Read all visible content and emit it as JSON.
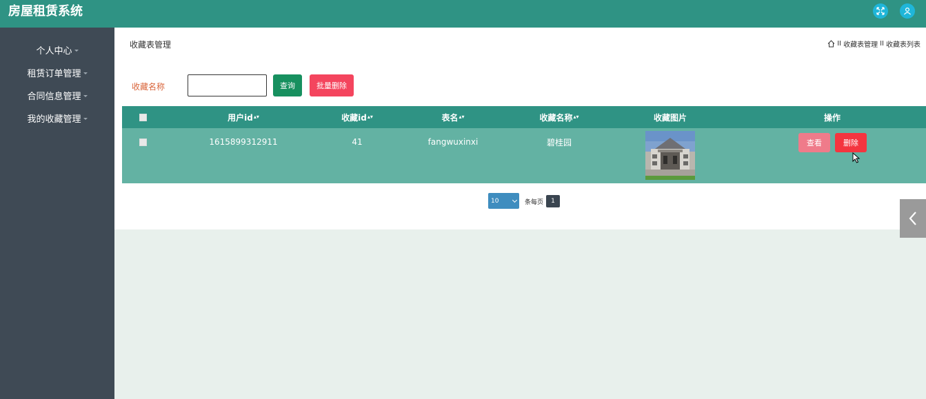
{
  "app": {
    "title": "房屋租赁系统"
  },
  "header": {
    "fullscreen_icon": "fullscreen-icon",
    "user_icon": "user-icon",
    "accent_color": "#1fb6d9",
    "bar_color": "#2f9384"
  },
  "sidebar": {
    "items": [
      {
        "label": "个人中心"
      },
      {
        "label": "租赁订单管理"
      },
      {
        "label": "合同信息管理"
      },
      {
        "label": "我的收藏管理"
      }
    ]
  },
  "page": {
    "title": "收藏表管理",
    "breadcrumb": [
      "收藏表管理",
      "收藏表列表"
    ],
    "breadcrumb_sep": "II"
  },
  "search": {
    "label": "收藏名称",
    "value": "",
    "placeholder": "",
    "query_button": "查询",
    "batch_delete_button": "批量删除"
  },
  "table": {
    "columns": [
      "用户id",
      "收藏id",
      "表名",
      "收藏名称",
      "收藏图片",
      "操作"
    ],
    "sortable": [
      true,
      true,
      true,
      true,
      false,
      false
    ],
    "rows": [
      {
        "userid": "1615899312911",
        "refid": "41",
        "tablename": "fangwuxinxi",
        "name": "碧桂园",
        "picture": "building-thumbnail",
        "view_label": "查看",
        "delete_label": "删除"
      }
    ]
  },
  "pagination": {
    "page_size": "10",
    "per_page_label": "条每页",
    "current_page": "1"
  }
}
